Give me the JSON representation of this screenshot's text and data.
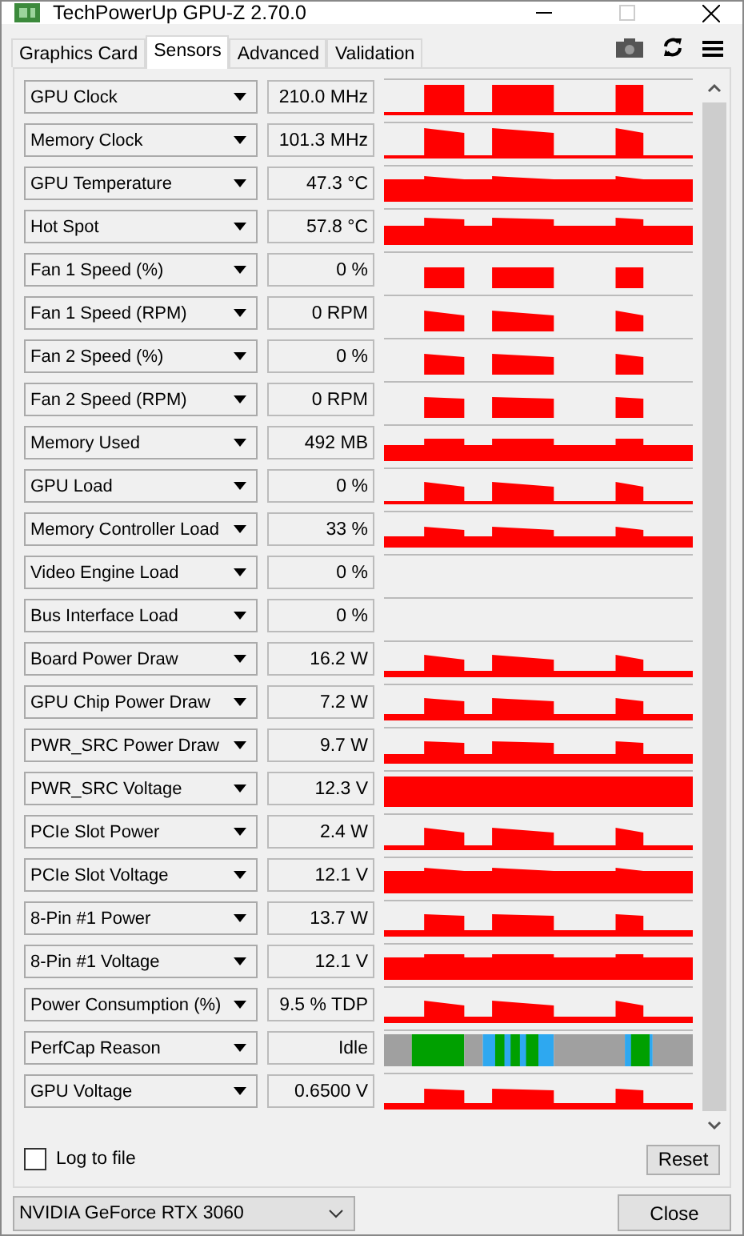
{
  "window": {
    "title": "TechPowerUp GPU-Z 2.70.0"
  },
  "tabs": [
    {
      "label": "Graphics Card",
      "selected": false
    },
    {
      "label": "Sensors",
      "selected": true
    },
    {
      "label": "Advanced",
      "selected": false
    },
    {
      "label": "Validation",
      "selected": false
    }
  ],
  "sensors": [
    {
      "name": "GPU Clock",
      "value": "210.0 MHz",
      "kind": "trace"
    },
    {
      "name": "Memory Clock",
      "value": "101.3 MHz",
      "kind": "trace"
    },
    {
      "name": "GPU Temperature",
      "value": "47.3 °C",
      "kind": "trace"
    },
    {
      "name": "Hot Spot",
      "value": "57.8 °C",
      "kind": "trace"
    },
    {
      "name": "Fan 1 Speed (%)",
      "value": "0 %",
      "kind": "trace"
    },
    {
      "name": "Fan 1 Speed (RPM)",
      "value": "0 RPM",
      "kind": "trace"
    },
    {
      "name": "Fan 2 Speed (%)",
      "value": "0 %",
      "kind": "trace"
    },
    {
      "name": "Fan 2 Speed (RPM)",
      "value": "0 RPM",
      "kind": "trace"
    },
    {
      "name": "Memory Used",
      "value": "492 MB",
      "kind": "trace"
    },
    {
      "name": "GPU Load",
      "value": "0 %",
      "kind": "trace"
    },
    {
      "name": "Memory Controller Load",
      "value": "33 %",
      "kind": "trace"
    },
    {
      "name": "Video Engine Load",
      "value": "0 %",
      "kind": "blank"
    },
    {
      "name": "Bus Interface Load",
      "value": "0 %",
      "kind": "blank"
    },
    {
      "name": "Board Power Draw",
      "value": "16.2 W",
      "kind": "trace"
    },
    {
      "name": "GPU Chip Power Draw",
      "value": "7.2 W",
      "kind": "trace"
    },
    {
      "name": "PWR_SRC Power Draw",
      "value": "9.7 W",
      "kind": "trace"
    },
    {
      "name": "PWR_SRC Voltage",
      "value": "12.3 V",
      "kind": "trace"
    },
    {
      "name": "PCIe Slot Power",
      "value": "2.4 W",
      "kind": "trace"
    },
    {
      "name": "PCIe Slot Voltage",
      "value": "12.1 V",
      "kind": "trace"
    },
    {
      "name": "8-Pin #1 Power",
      "value": "13.7 W",
      "kind": "trace"
    },
    {
      "name": "8-Pin #1 Voltage",
      "value": "12.1 V",
      "kind": "trace"
    },
    {
      "name": "Power Consumption (%)",
      "value": "9.5 % TDP",
      "kind": "trace"
    },
    {
      "name": "PerfCap Reason",
      "value": "Idle",
      "kind": "perfcap"
    },
    {
      "name": "GPU Voltage",
      "value": "0.6500 V",
      "kind": "trace"
    }
  ],
  "log_to_file": {
    "label": "Log to file",
    "checked": false
  },
  "reset_button": "Reset",
  "device": "NVIDIA GeForce RTX 3060",
  "close_button": "Close"
}
